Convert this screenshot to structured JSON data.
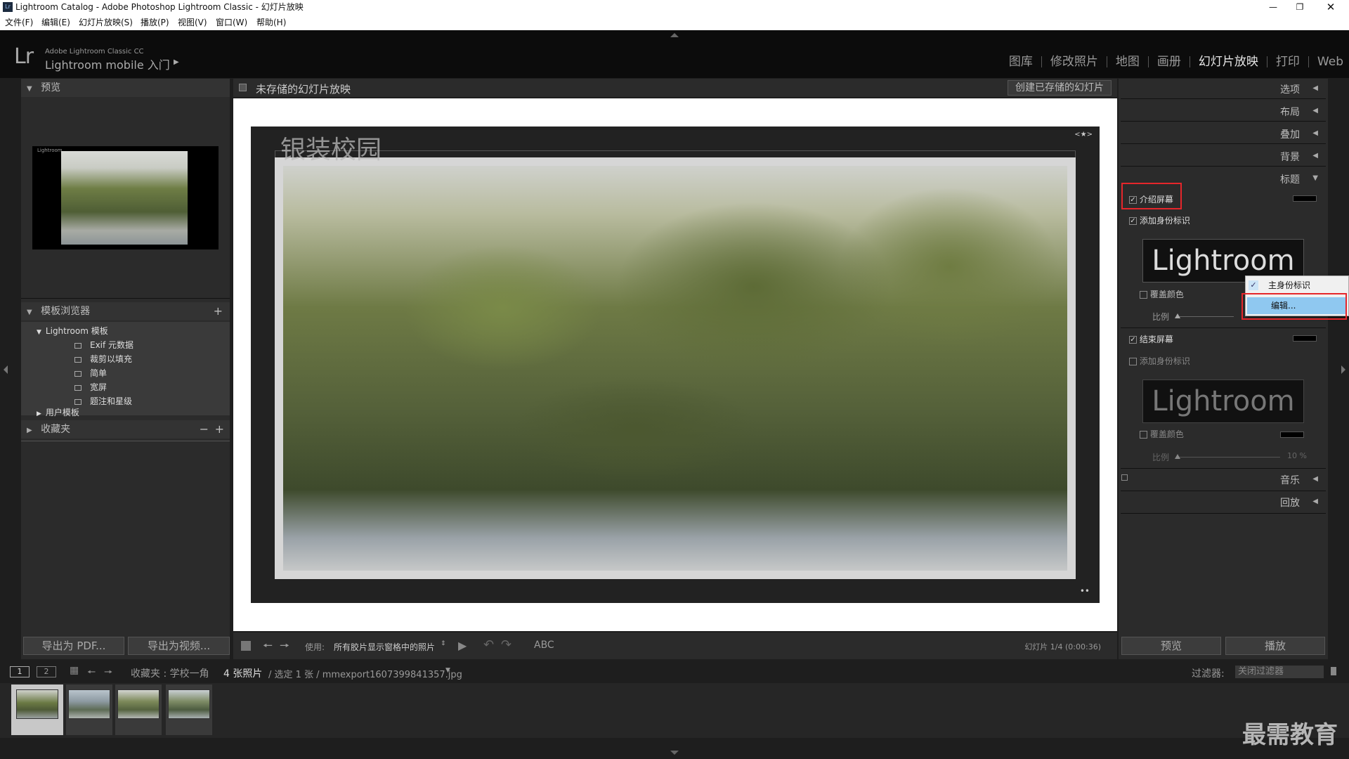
{
  "window": {
    "title": "Lightroom Catalog - Adobe Photoshop Lightroom Classic - 幻灯片放映",
    "app_icon": "Lr"
  },
  "menu": [
    "文件(F)",
    "编辑(E)",
    "幻灯片放映(S)",
    "播放(P)",
    "视图(V)",
    "窗口(W)",
    "帮助(H)"
  ],
  "identity": {
    "logo": "Lr",
    "sub": "Adobe Lightroom Classic CC",
    "main": "Lightroom mobile 入门"
  },
  "modules": [
    "图库",
    "修改照片",
    "地图",
    "画册",
    "幻灯片放映",
    "打印",
    "Web"
  ],
  "active_module": "幻灯片放映",
  "left": {
    "preview_header": "预览",
    "preview_badge": "Lightroom",
    "template_header": "模板浏览器",
    "lightroom_templates": "Lightroom 模板",
    "templates": [
      "Exif 元数据",
      "裁剪以填充",
      "简单",
      "宽屏",
      "题注和星级"
    ],
    "user_templates": "用户模板",
    "collections_header": "收藏夹",
    "export_pdf": "导出为 PDF...",
    "export_video": "导出为视频..."
  },
  "center": {
    "title": "未存储的幻灯片放映",
    "create_saved": "创建已存储的幻灯片",
    "slide_text": "银装校园",
    "use_label": "使用:",
    "use_value": "所有胶片显示窗格中的照片",
    "abc": "ABC",
    "slide_count": "幻灯片 1/4 (0:00:36)"
  },
  "right": {
    "sections": [
      "选项",
      "布局",
      "叠加",
      "背景",
      "标题"
    ],
    "intro_screen": "介绍屏幕",
    "add_identity": "添加身份标识",
    "identity_text": "Lightroom",
    "override_color": "覆盖颜色",
    "scale_label": "比例",
    "ending_screen": "结束屏幕",
    "add_identity2": "添加身份标识",
    "identity_text2": "Lightroom",
    "override_color2": "覆盖颜色",
    "scale_label2": "比例",
    "scale_value2": "10 %",
    "music": "音乐",
    "playback": "回放",
    "preview_btn": "预览",
    "play_btn": "播放"
  },
  "popup": {
    "item1": "主身份标识",
    "item2": "编辑..."
  },
  "filmstrip": {
    "page1": "1",
    "page2": "2",
    "source": "收藏夹 : 学校一角",
    "count": "4 张照片",
    "selected": "/ 选定 1 张 / mmexport1607399841357.jpg",
    "filter_label": "过滤器:",
    "filter_value": "关闭过滤器"
  },
  "watermark": "最需教育",
  "colors": {
    "accent_red": "#e5262b",
    "selection_blue": "#8fc8f0",
    "panel": "#2b2b2b"
  }
}
